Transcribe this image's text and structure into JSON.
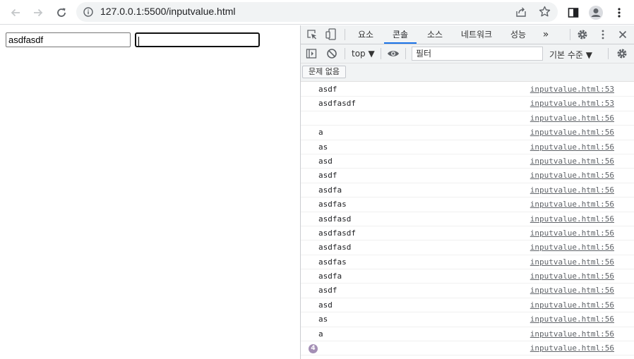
{
  "browser": {
    "url": "127.0.0.1:5500/inputvalue.html"
  },
  "page": {
    "input1_value": "asdfasdf",
    "input2_value": ""
  },
  "devtools": {
    "tabs": [
      {
        "label": "요소",
        "active": false
      },
      {
        "label": "콘솔",
        "active": true
      },
      {
        "label": "소스",
        "active": false
      },
      {
        "label": "네트워크",
        "active": false
      },
      {
        "label": "성능",
        "active": false
      }
    ],
    "more_tabs": "»",
    "context": "top ▼",
    "filter_placeholder": "필터",
    "levels": "기본 수준 ▼",
    "issues_button": "문제 없음",
    "accent_color": "#1a73e8",
    "log": [
      {
        "message": "asdf",
        "source": "inputvalue.html:53"
      },
      {
        "message": "asdfasdf",
        "source": "inputvalue.html:53"
      },
      {
        "message": "",
        "source": "inputvalue.html:56"
      },
      {
        "message": "a",
        "source": "inputvalue.html:56"
      },
      {
        "message": "as",
        "source": "inputvalue.html:56"
      },
      {
        "message": "asd",
        "source": "inputvalue.html:56"
      },
      {
        "message": "asdf",
        "source": "inputvalue.html:56"
      },
      {
        "message": "asdfa",
        "source": "inputvalue.html:56"
      },
      {
        "message": "asdfas",
        "source": "inputvalue.html:56"
      },
      {
        "message": "asdfasd",
        "source": "inputvalue.html:56"
      },
      {
        "message": "asdfasdf",
        "source": "inputvalue.html:56"
      },
      {
        "message": "asdfasd",
        "source": "inputvalue.html:56"
      },
      {
        "message": "asdfas",
        "source": "inputvalue.html:56"
      },
      {
        "message": "asdfa",
        "source": "inputvalue.html:56"
      },
      {
        "message": "asdf",
        "source": "inputvalue.html:56"
      },
      {
        "message": "asd",
        "source": "inputvalue.html:56"
      },
      {
        "message": "as",
        "source": "inputvalue.html:56"
      },
      {
        "message": "a",
        "source": "inputvalue.html:56"
      },
      {
        "message": "",
        "source": "inputvalue.html:56",
        "repeat_badge": "4"
      }
    ]
  }
}
